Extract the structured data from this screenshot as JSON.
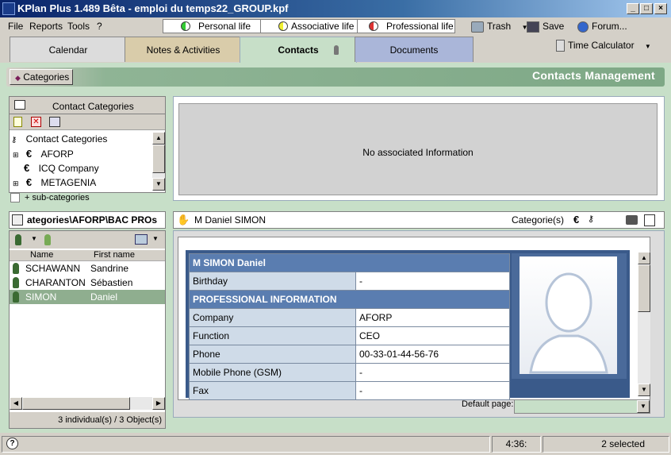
{
  "window": {
    "title": "KPlan Plus 1.489 Bêta - emploi du temps22_GROUP.kpf"
  },
  "menu": {
    "file": "File",
    "reports": "Reports",
    "tools": "Tools",
    "help": "?"
  },
  "life_tabs": {
    "personal": "Personal life",
    "associative": "Associative life",
    "professional": "Professional life"
  },
  "toolbar": {
    "trash": "Trash",
    "save": "Save",
    "forum": "Forum...",
    "time_calculator": "Time Calculator"
  },
  "tabs": {
    "calendar": "Calendar",
    "notes": "Notes & Activities",
    "contacts": "Contacts",
    "documents": "Documents"
  },
  "category_bar": {
    "button": "Categories",
    "title": "Contacts Management"
  },
  "contact_categories": {
    "header": "Contact Categories",
    "root": "Contact Categories",
    "items": [
      {
        "label": "AFORP"
      },
      {
        "label": "ICQ Company"
      },
      {
        "label": "METAGENIA"
      }
    ],
    "subcat_label": "+ sub-categories"
  },
  "associated": {
    "text": "No associated Information"
  },
  "path": {
    "text": "ategories\\AFORP\\BAC PROs"
  },
  "contact_list": {
    "columns": {
      "name": "Name",
      "first_name": "First name"
    },
    "rows": [
      {
        "name": "SCHAWANN",
        "first": "Sandrine"
      },
      {
        "name": "CHARANTON",
        "first": "Sébastien"
      },
      {
        "name": "SIMON",
        "first": "Daniel"
      }
    ],
    "summary": "3 individual(s) / 3 Object(s)"
  },
  "detail": {
    "header_name": "M Daniel SIMON",
    "categories_label": "Categorie(s)",
    "card_name": "M SIMON Daniel",
    "birthday_label": "Birthday",
    "birthday_value": "-",
    "pro_section": "PROFESSIONAL INFORMATION",
    "company_label": "Company",
    "company_value": "AFORP",
    "function_label": "Function",
    "function_value": "CEO",
    "phone_label": "Phone",
    "phone_value": "00-33-01-44-56-76",
    "mobile_label": "Mobile Phone (GSM)",
    "mobile_value": "-",
    "fax_label": "Fax",
    "fax_value": "-",
    "default_page_label": "Default page:"
  },
  "status": {
    "time": "4:36:",
    "selected": "2 selected"
  },
  "colors": {
    "accent_green": "#7ea886",
    "title_blue": "#0a246a",
    "section_blue": "#5a7db0"
  }
}
